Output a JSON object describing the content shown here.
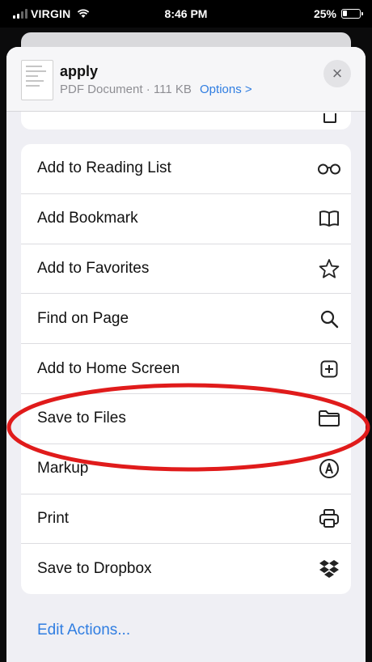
{
  "status_bar": {
    "carrier": "VIRGIN",
    "time": "8:46 PM",
    "battery": "25%"
  },
  "file": {
    "name": "apply",
    "details": "PDF Document · 111 KB",
    "options_label": "Options >"
  },
  "actions": [
    {
      "label": "Add to Reading List",
      "icon": "glasses-icon"
    },
    {
      "label": "Add Bookmark",
      "icon": "book-icon"
    },
    {
      "label": "Add to Favorites",
      "icon": "star-icon"
    },
    {
      "label": "Find on Page",
      "icon": "search-icon"
    },
    {
      "label": "Add to Home Screen",
      "icon": "add-square-icon"
    },
    {
      "label": "Save to Files",
      "icon": "folder-icon"
    },
    {
      "label": "Markup",
      "icon": "markup-icon"
    },
    {
      "label": "Print",
      "icon": "printer-icon"
    },
    {
      "label": "Save to Dropbox",
      "icon": "dropbox-icon"
    }
  ],
  "edit_actions_label": "Edit Actions...",
  "colors": {
    "accent": "#2f7de1",
    "annotation": "#e01b1b"
  }
}
